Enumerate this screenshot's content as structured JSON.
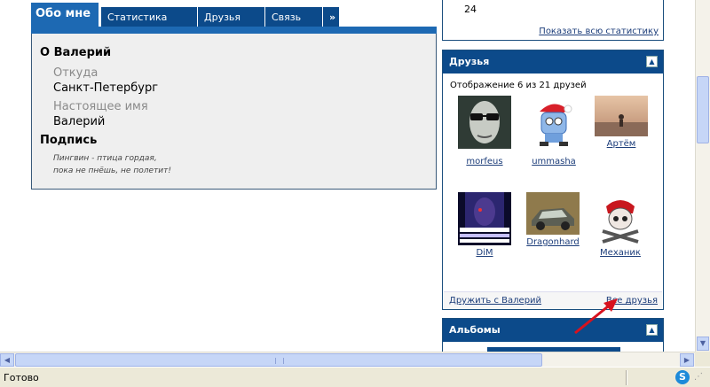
{
  "profile": {
    "tabs": [
      {
        "label": "Обо мне",
        "active": true
      },
      {
        "label": "Статистика"
      },
      {
        "label": "Друзья"
      },
      {
        "label": "Связь"
      },
      {
        "label": "»"
      }
    ],
    "about_title": "О Валерий",
    "from_label": "Откуда",
    "from_value": "Санкт-Петербург",
    "realname_label": "Настоящее имя",
    "realname_value": "Валерий",
    "signature_title": "Подпись",
    "signature_line1": "Пингвин - птица гордая,",
    "signature_line2": "пока не пнёшь, не полетит!"
  },
  "stats": {
    "number": "24",
    "show_all_link": "Показать всю статистику"
  },
  "friends": {
    "title": "Друзья",
    "count_text": "Отображение 6 из 21 друзей",
    "list": [
      {
        "name": "morfeus",
        "icon": "morpheus-avatar"
      },
      {
        "name": "ummasha",
        "icon": "robot-santa-avatar"
      },
      {
        "name": "Артём",
        "icon": "sunset-person-avatar"
      },
      {
        "name": "DiM",
        "icon": "terminator-avatar"
      },
      {
        "name": "Dragonhard",
        "icon": "car-avatar"
      },
      {
        "name": "Механик",
        "icon": "pirate-skull-avatar"
      }
    ],
    "befriend_link": "Дружить с Валерий",
    "all_friends_link": "Все друзья"
  },
  "albums": {
    "title": "Альбомы"
  },
  "status": {
    "text": "Готово"
  },
  "colors": {
    "header_blue": "#0c4a8a",
    "tab_active": "#1d69b3",
    "annotation_arrow": "#d8121e"
  }
}
